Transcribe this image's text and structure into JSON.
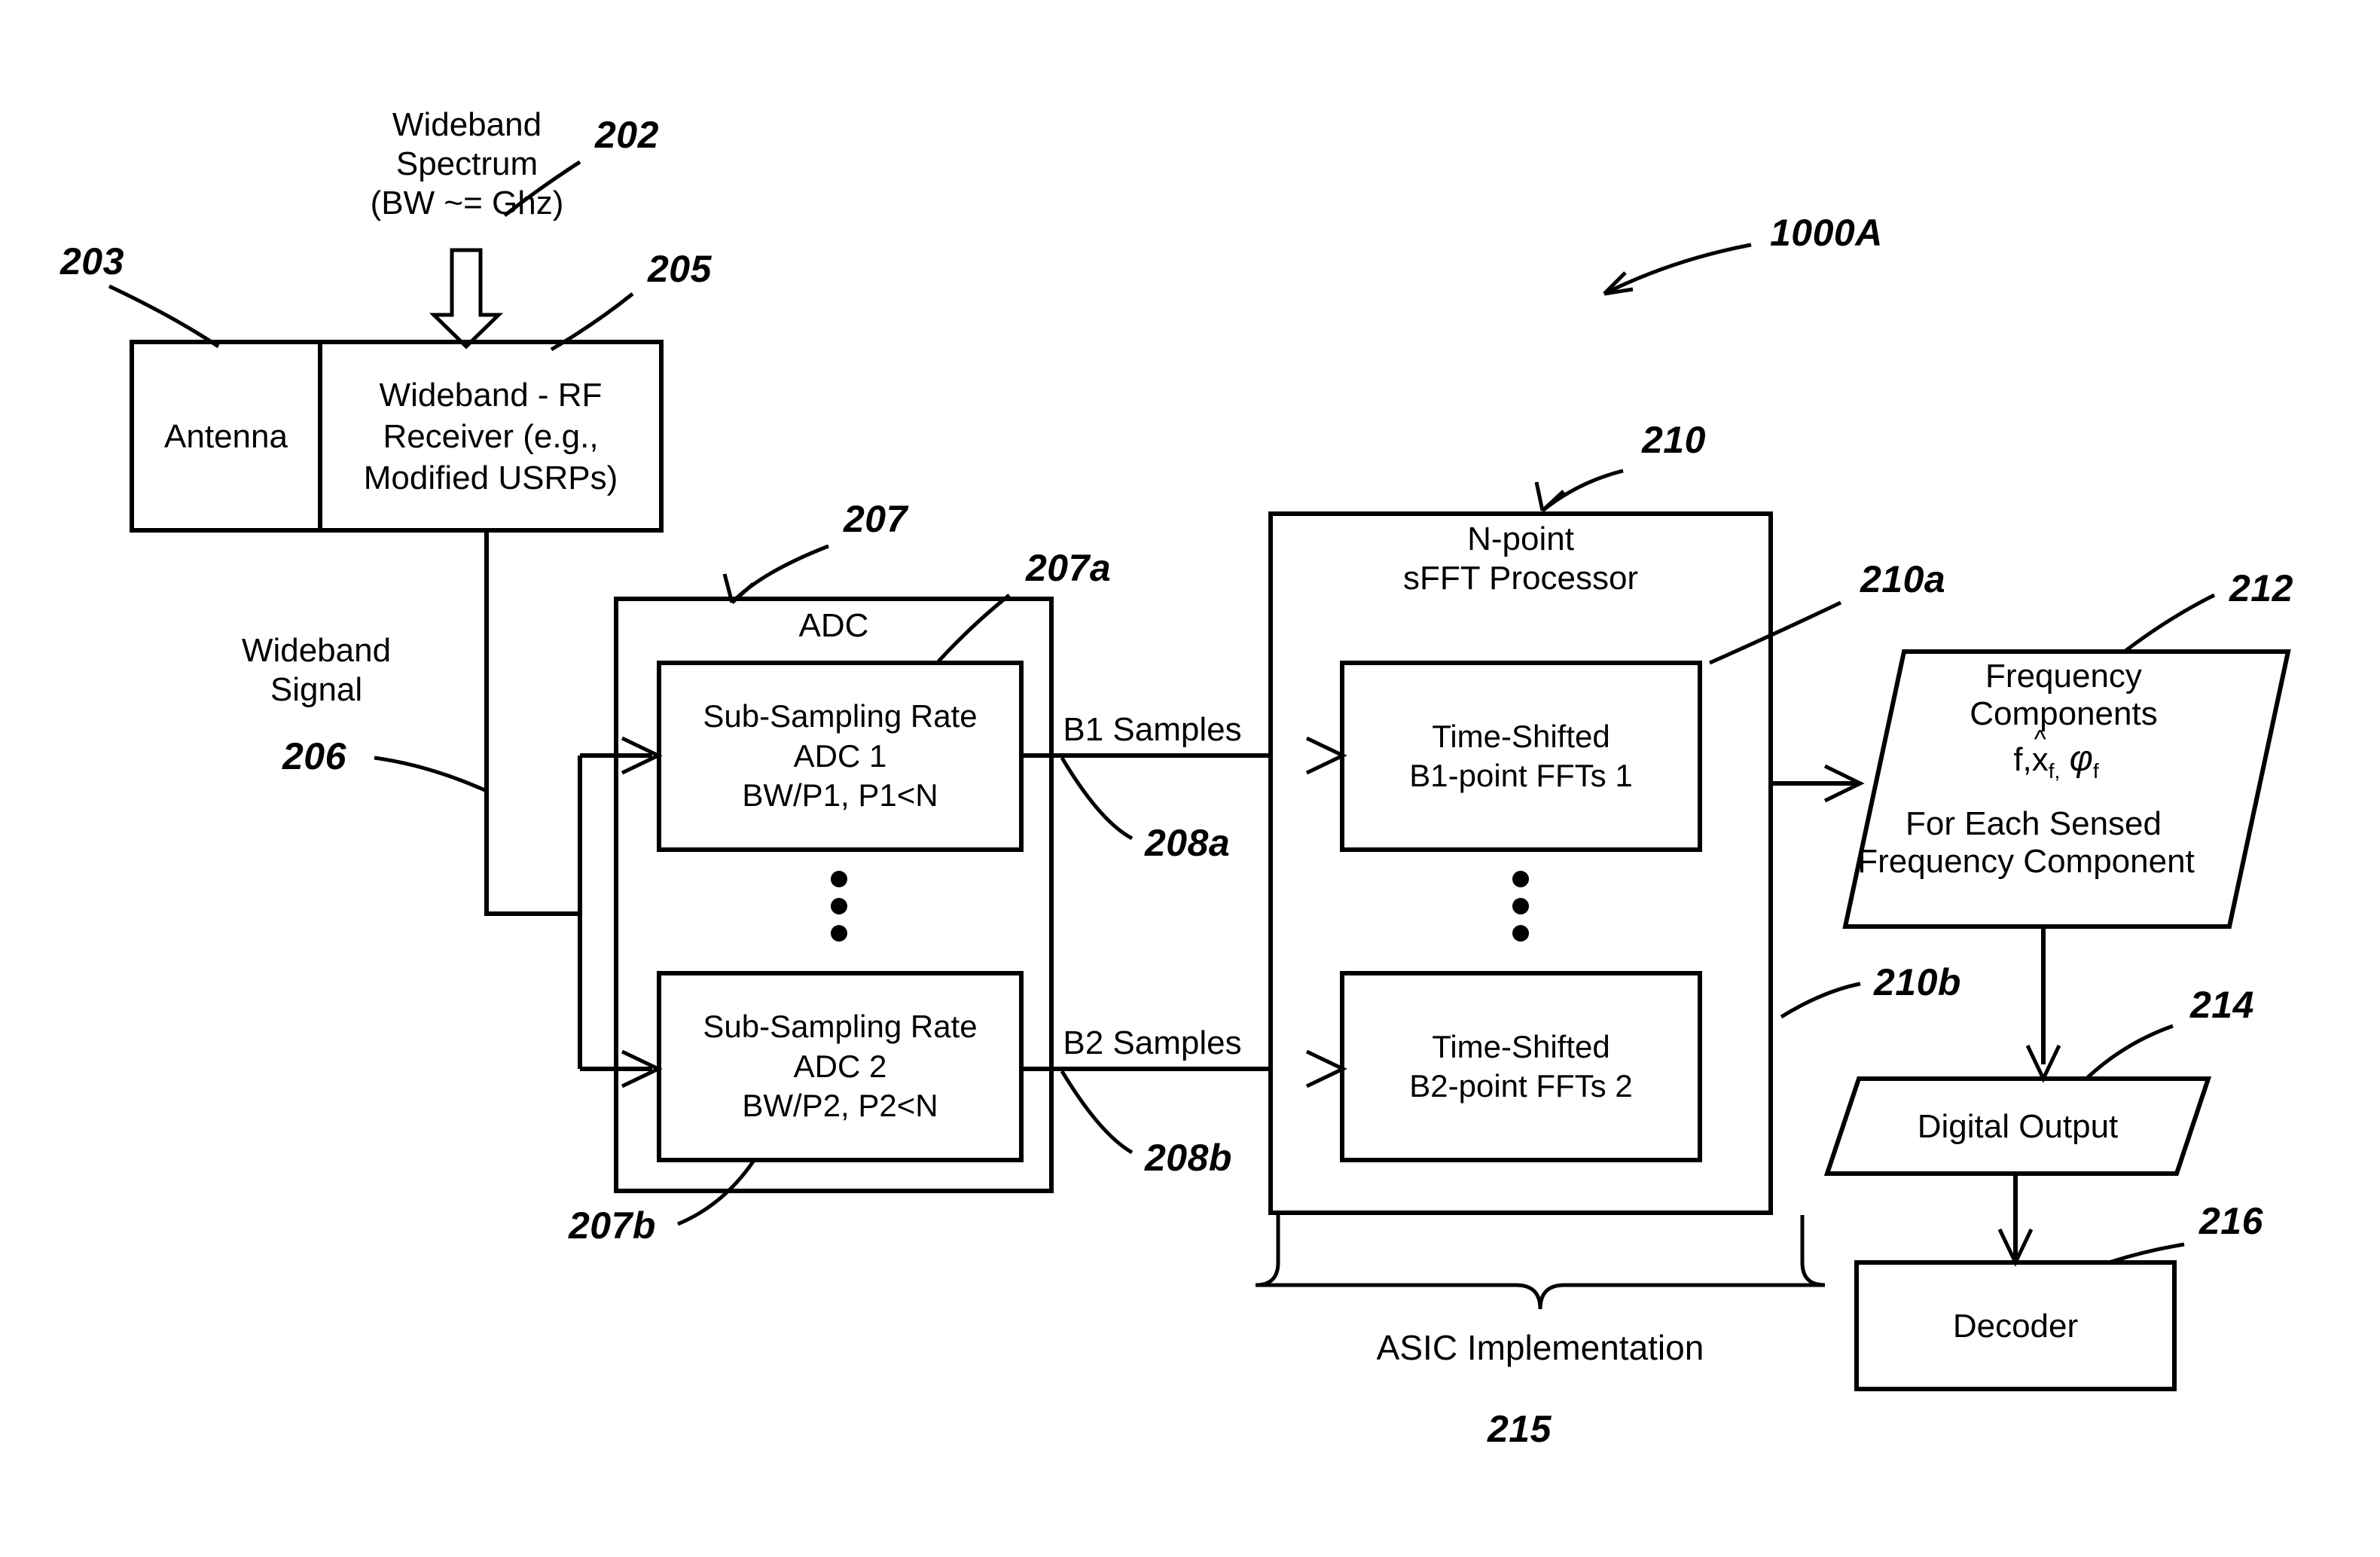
{
  "figure": {
    "id": "1000A",
    "type": "patent-block-diagram"
  },
  "labels": {
    "wideband_spectrum": "Wideband\nSpectrum\n(BW ~= Ghz)",
    "wideband_signal": "Wideband\nSignal",
    "b1_samples": "B1 Samples",
    "b2_samples": "B2 Samples",
    "asic_implementation": "ASIC Implementation"
  },
  "blocks": {
    "antenna": "Antenna",
    "rf_receiver": "Wideband - RF\nReceiver (e.g.,\nModified USRPs)",
    "adc_title": "ADC",
    "adc1": "Sub-Sampling Rate\nADC 1\nBW/P1, P1<N",
    "adc2": "Sub-Sampling Rate\nADC 2\nBW/P2, P2<N",
    "sfft_title": "N-point\nsFFT Processor",
    "fft1": "Time-Shifted\nB1-point FFTs 1",
    "fft2": "Time-Shifted\nB2-point FFTs 2",
    "freq_components_line1": "Frequency",
    "freq_components_line2": "Components",
    "freq_components_line4": "For Each Sensed",
    "freq_components_line5": "Frequency Component",
    "freq_formula": {
      "f": "f,",
      "x": "x",
      "hat": "^",
      "sub_f1": "f,",
      "phi": "φ",
      "sub_f2": "f"
    },
    "digital_output": "Digital Output",
    "decoder": "Decoder"
  },
  "reference_numerals": {
    "r202": "202",
    "r203": "203",
    "r205": "205",
    "r206": "206",
    "r207": "207",
    "r207a": "207a",
    "r207b": "207b",
    "r208a": "208a",
    "r208b": "208b",
    "r210": "210",
    "r210a": "210a",
    "r210b": "210b",
    "r212": "212",
    "r214": "214",
    "r215": "215",
    "r216": "216",
    "r1000a": "1000A"
  },
  "colors": {
    "stroke": "#000000",
    "background": "#ffffff"
  }
}
